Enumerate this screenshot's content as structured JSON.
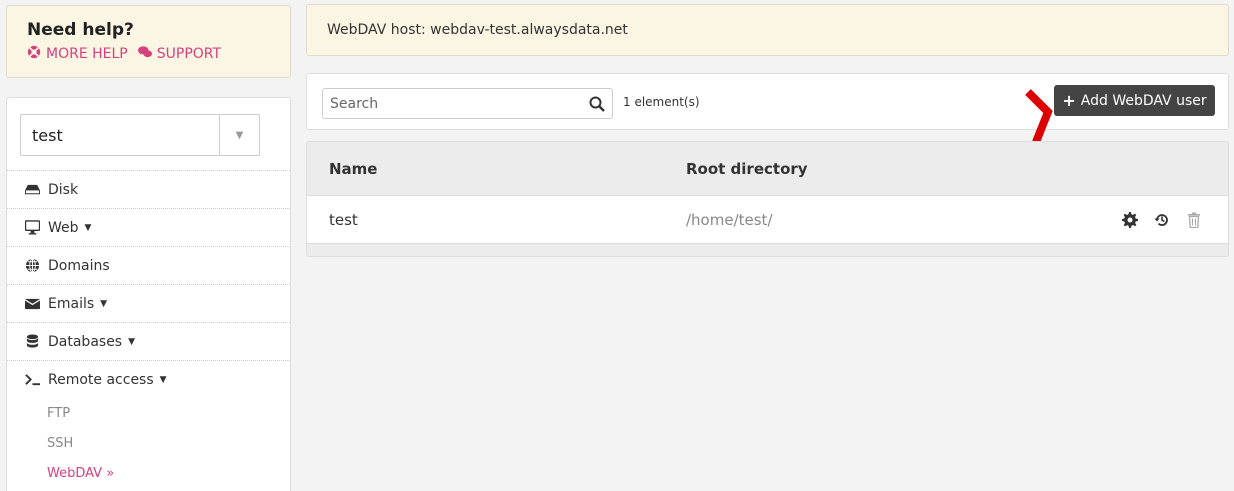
{
  "help": {
    "title": "Need help?",
    "more_help": "MORE HELP",
    "support": "SUPPORT"
  },
  "account": {
    "selected": "test"
  },
  "nav": {
    "disk": "Disk",
    "web": "Web",
    "domains": "Domains",
    "emails": "Emails",
    "databases": "Databases",
    "remote_access": "Remote access",
    "ftp": "FTP",
    "ssh": "SSH",
    "webdav": "WebDAV »"
  },
  "host": {
    "text": "WebDAV host: webdav-test.alwaysdata.net"
  },
  "toolbar": {
    "search_placeholder": "Search",
    "count": "1 element(s)",
    "add_label": "Add WebDAV user"
  },
  "table": {
    "headers": [
      "Name",
      "Root directory"
    ],
    "rows": [
      {
        "name": "test",
        "root": "/home/test/"
      }
    ]
  },
  "colors": {
    "accent": "#d6407f",
    "help_bg": "#faf6e3",
    "button_bg": "#444444",
    "marker": "#dd0000"
  }
}
